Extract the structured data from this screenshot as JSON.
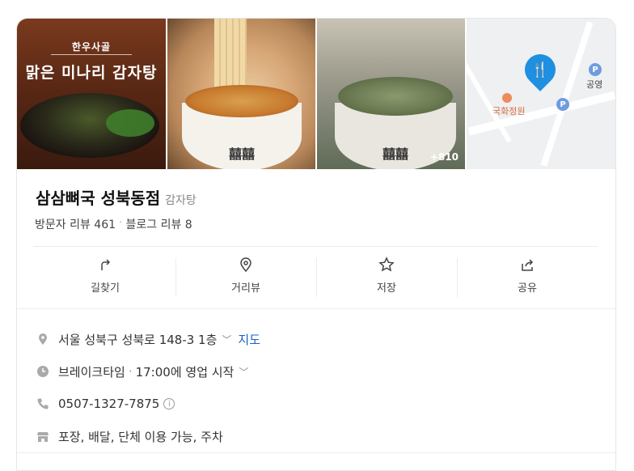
{
  "photos": {
    "promo_small": "한우사골",
    "promo_big": "맑은 미나리 감자탕",
    "bowl_logo": "囍囍",
    "more_count": "+810"
  },
  "map": {
    "poi_label": "국화정원",
    "park_label": "공영",
    "parking_symbol": "P",
    "marker_icon": "restaurant-icon"
  },
  "place": {
    "name": "삼삼뼈국 성북동점",
    "category": "감자탕",
    "visitor_reviews": "방문자 리뷰 461",
    "separator": "·",
    "blog_reviews": "블로그 리뷰 8"
  },
  "actions": [
    {
      "label": "길찾기",
      "icon": "directions-icon"
    },
    {
      "label": "거리뷰",
      "icon": "street-view-icon"
    },
    {
      "label": "저장",
      "icon": "star-icon"
    },
    {
      "label": "공유",
      "icon": "share-icon"
    }
  ],
  "info": {
    "address": "서울 성북구 성북로 148-3 1층",
    "map_link": "지도",
    "status": "브레이크타임",
    "status_sep": "·",
    "hours_note": "17:00에 영업 시작",
    "phone": "0507-1327-7875",
    "info_symbol": "i",
    "amenities": "포장, 배달, 단체 이용 가능, 주차"
  },
  "colors": {
    "link": "#1a5fc7",
    "map_marker": "#1e8fe1",
    "poi": "#f08a5d"
  }
}
